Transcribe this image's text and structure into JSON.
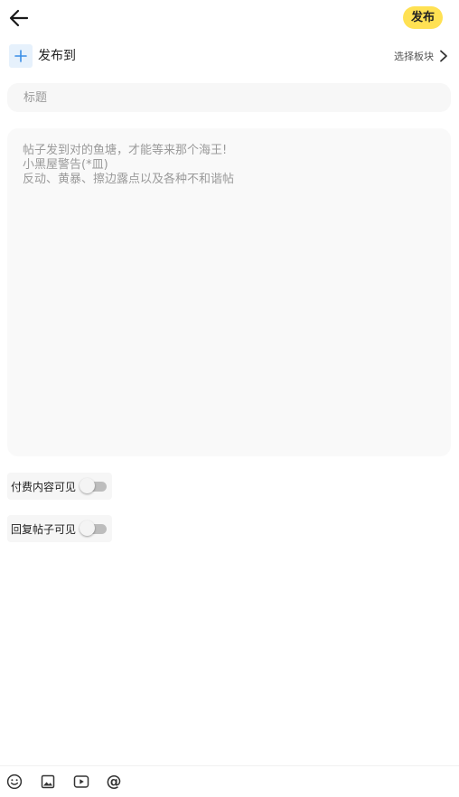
{
  "header": {
    "back_icon": "arrow-left-icon",
    "publish_label": "发布"
  },
  "publish_to": {
    "add_icon": "plus-icon",
    "label": "发布到",
    "select_board_label": "选择板块",
    "chevron_icon": "chevron-right-icon"
  },
  "title_input": {
    "placeholder": "标题",
    "value": ""
  },
  "content_input": {
    "placeholder": "帖子发到对的鱼塘，才能等来那个海王!\n小黑屋警告(*皿)\n反动、黄暴、擦边露点以及各种不和谐帖",
    "value": ""
  },
  "toggles": [
    {
      "label": "付费内容可见",
      "on": false
    },
    {
      "label": "回复帖子可见",
      "on": false
    }
  ],
  "toolbar": {
    "emoji_icon": "emoji-icon",
    "image_icon": "image-icon",
    "video_icon": "video-icon",
    "mention_icon": "at-mention-icon",
    "mention_glyph": "@"
  },
  "colors": {
    "accent": "#ffe153",
    "add_box_bg": "#e6f1fc",
    "add_box_icon": "#3a8ee6",
    "input_bg": "#f7f7f7",
    "toggle_row_bg": "#f6f6f6",
    "switch_track_off": "#bdbdbd",
    "placeholder": "#9a9a9a"
  }
}
